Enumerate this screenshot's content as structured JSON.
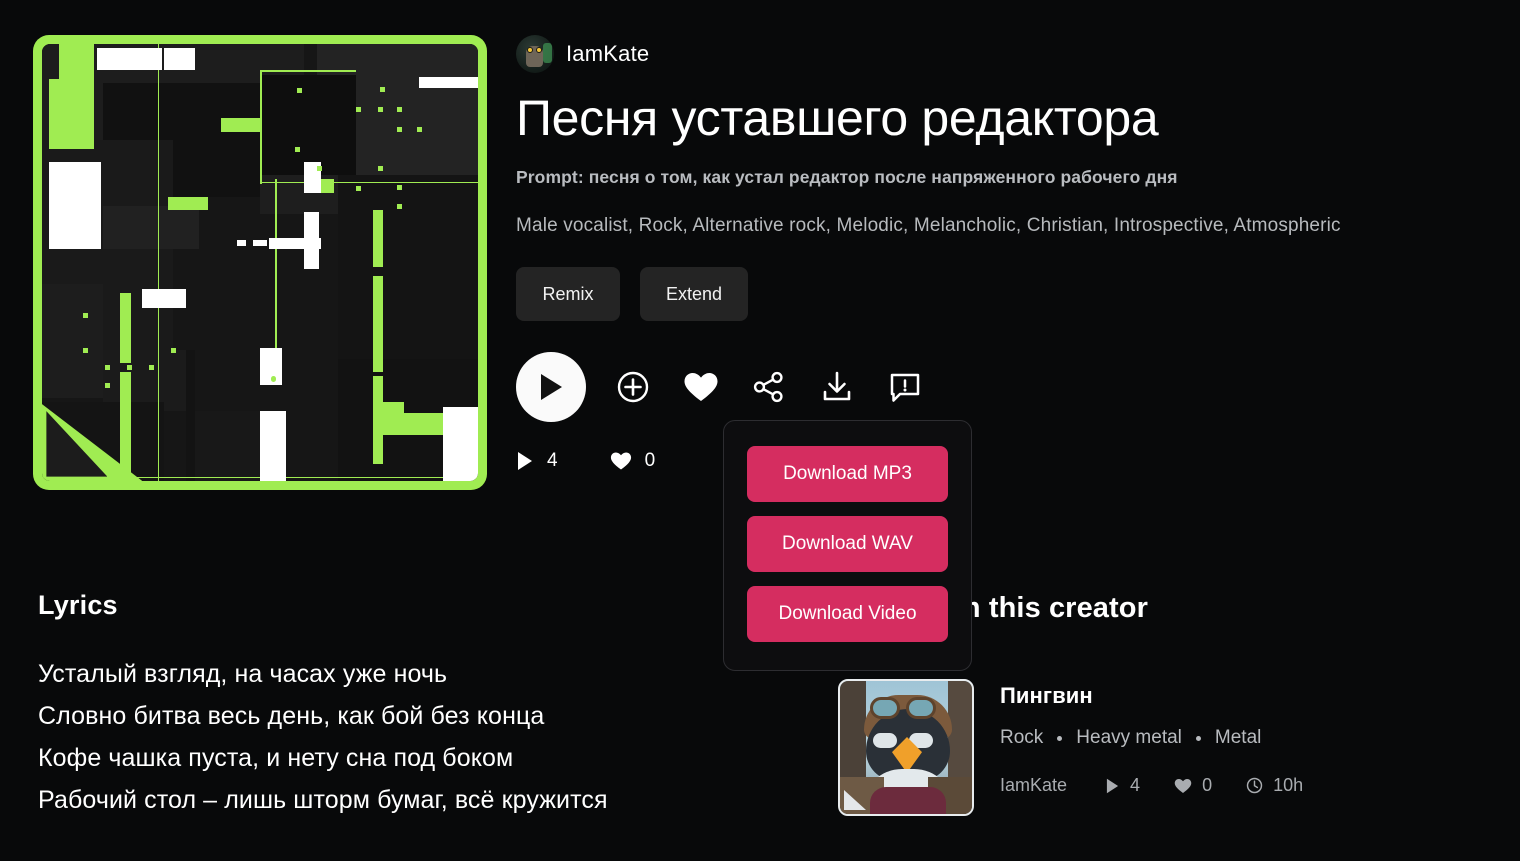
{
  "colors": {
    "background": "#08090a",
    "accent_green": "#a0ec52",
    "accent_pink": "#d52d60",
    "button_gray": "#242424",
    "muted_text": "#b7babd"
  },
  "header": {
    "creator_name": "IamKate",
    "avatar_icon": "owl-avatar",
    "song_title": "Песня уставшего редактора",
    "prompt": "Prompt: песня о том, как устал редактор после напряженного рабочего дня",
    "tags": "Male vocalist, Rock, Alternative rock, Melodic, Melancholic, Christian, Introspective, Atmospheric"
  },
  "actions": {
    "remix_label": "Remix",
    "extend_label": "Extend",
    "icons": [
      {
        "name": "play-icon",
        "label": "Play"
      },
      {
        "name": "plus-circle-icon",
        "label": "Add to playlist"
      },
      {
        "name": "heart-icon",
        "label": "Like"
      },
      {
        "name": "share-icon",
        "label": "Share"
      },
      {
        "name": "download-icon",
        "label": "Download"
      },
      {
        "name": "report-icon",
        "label": "Report"
      }
    ]
  },
  "stats": {
    "play_icon": "play-triangle-icon",
    "play_count": "4",
    "like_icon": "heart-icon",
    "like_count": "0"
  },
  "download_menu": {
    "visible": true,
    "items": [
      {
        "label": "Download MP3"
      },
      {
        "label": "Download WAV"
      },
      {
        "label": "Download Video"
      }
    ]
  },
  "lyrics": {
    "heading": "Lyrics",
    "lines": [
      "Усталый взгляд, на часах уже ночь",
      "Словно битва весь день, как бой без конца",
      "Кофе чашка пуста, и нету сна под боком",
      "Рабочий стол – лишь шторм бумаг, всё кружится"
    ]
  },
  "more_from_creator": {
    "heading": "More from this creator",
    "songs": [
      {
        "title": "Пингвин",
        "thumb_icon": "penguin-aviator-thumbnail",
        "genres": [
          "Rock",
          "Heavy metal",
          "Metal"
        ],
        "uploader": "IamKate",
        "play_count": "4",
        "like_count": "0",
        "age": "10h"
      }
    ]
  },
  "album_art": {
    "name": "abstract-geometric-cover",
    "border_color": "#a0ec52",
    "base_color": "#161616"
  }
}
